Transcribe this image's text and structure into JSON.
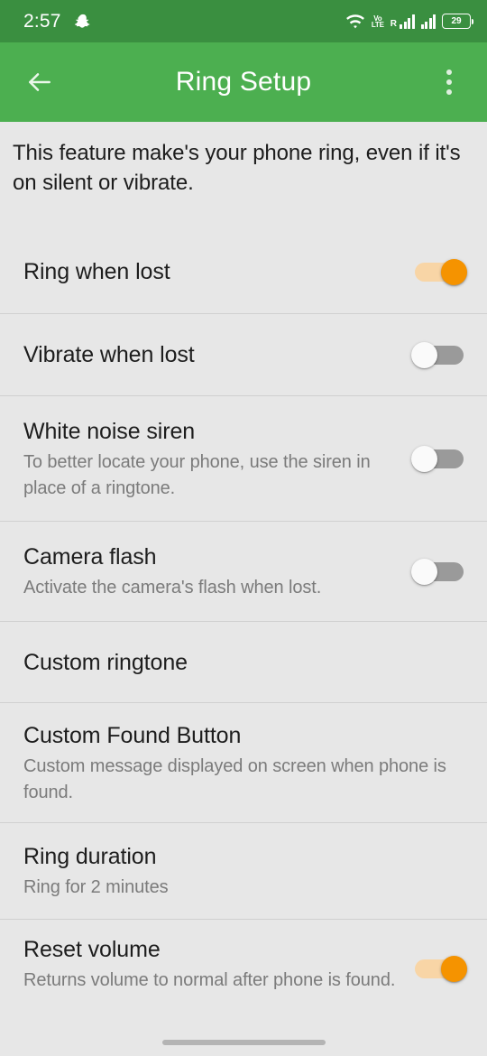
{
  "status_bar": {
    "clock": "2:57",
    "notification_icon": "snapchat-icon",
    "wifi_icon": "wifi-icon",
    "volte_line1": "Vo",
    "volte_line2": "LTE",
    "roaming_letter": "R",
    "battery_percent": "29"
  },
  "app_bar": {
    "back_icon": "back-arrow-icon",
    "title": "Ring Setup",
    "overflow_icon": "overflow-menu-icon"
  },
  "intro": {
    "text": "This feature make's your phone ring, even if it's on silent or vibrate."
  },
  "settings": [
    {
      "title": "Ring when lost",
      "subtitle": "",
      "control": "toggle",
      "state": "on"
    },
    {
      "title": "Vibrate when lost",
      "subtitle": "",
      "control": "toggle",
      "state": "off"
    },
    {
      "title": "White noise siren",
      "subtitle": "To better locate your phone, use the siren in place of a ringtone.",
      "control": "toggle",
      "state": "off"
    },
    {
      "title": "Camera flash",
      "subtitle": "Activate the camera's flash when lost.",
      "control": "toggle",
      "state": "off"
    },
    {
      "title": "Custom ringtone",
      "subtitle": "",
      "control": "none",
      "state": ""
    },
    {
      "title": "Custom Found Button",
      "subtitle": "Custom message displayed on screen when phone is found.",
      "control": "none",
      "state": ""
    },
    {
      "title": "Ring duration",
      "subtitle": "Ring for 2 minutes",
      "control": "none",
      "state": ""
    },
    {
      "title": "Reset volume",
      "subtitle": "Returns volume to normal after phone is found.",
      "control": "toggle",
      "state": "on"
    }
  ],
  "colors": {
    "status_bar": "#3a8f40",
    "app_bar": "#4caf50",
    "background": "#e7e7e7",
    "toggle_on_thumb": "#f59300",
    "toggle_on_track": "#f8d5a6",
    "toggle_off_track": "#9a9a9a",
    "toggle_off_thumb": "#fafafa",
    "primary_text": "#1d1d1d",
    "secondary_text": "#7b7b7b",
    "divider": "#d0d0d0"
  },
  "gesture_bar": {
    "pill": "home-gesture-pill"
  }
}
